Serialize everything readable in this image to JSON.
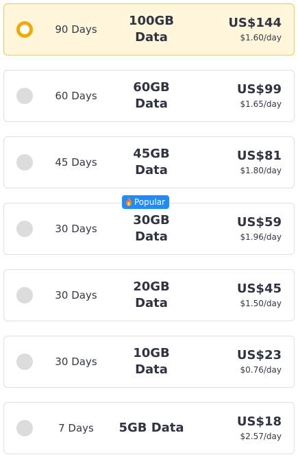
{
  "plans": [
    {
      "days": "90 Days",
      "data_line1": "100GB",
      "data_line2": "Data",
      "price": "US$144",
      "per_day": "$1.60/day",
      "selected": true
    },
    {
      "days": "60 Days",
      "data_line1": "60GB",
      "data_line2": "Data",
      "price": "US$99",
      "per_day": "$1.65/day",
      "selected": false
    },
    {
      "days": "45 Days",
      "data_line1": "45GB",
      "data_line2": "Data",
      "price": "US$81",
      "per_day": "$1.80/day",
      "selected": false
    },
    {
      "days": "30 Days",
      "data_line1": "30GB",
      "data_line2": "Data",
      "price": "US$59",
      "per_day": "$1.96/day",
      "selected": false
    },
    {
      "days": "30 Days",
      "data_line1": "20GB",
      "data_line2": "Data",
      "price": "US$45",
      "per_day": "$1.50/day",
      "selected": false
    },
    {
      "days": "30 Days",
      "data_line1": "10GB",
      "data_line2": "Data",
      "price": "US$23",
      "per_day": "$0.76/day",
      "selected": false
    },
    {
      "days": "7 Days",
      "data_single": "5GB Data",
      "price": "US$18",
      "per_day": "$2.57/day",
      "selected": false
    }
  ],
  "popular_badge": {
    "label": "Popular",
    "icon": "flame-icon"
  },
  "colors": {
    "selected_bg": "#fff6dc",
    "selected_border": "#f4c64b",
    "radio_checked": "#f5a800",
    "radio_unchecked": "#dcdcdc",
    "badge_bg": "#1f8bff",
    "text": "#2f3440"
  }
}
